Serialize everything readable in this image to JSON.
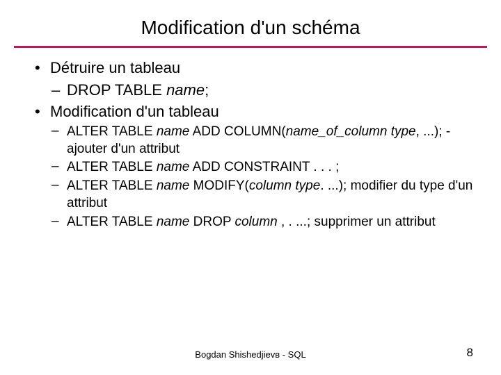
{
  "title": "Modification d'un schéma",
  "bullets": {
    "b1": "Détruire un tableau",
    "b1_1_pre": "DROP TABLE ",
    "b1_1_it": "name",
    "b1_1_post": ";",
    "b2": "Modification d'un tableau",
    "b2_1_a": "ALTER TABLE ",
    "b2_1_b": "name",
    "b2_1_c": " ADD COLUMN(",
    "b2_1_d": "name_of_column type",
    "b2_1_e": ", ...);  - ajouter d'un attribut",
    "b2_2_a": "ALTER TABLE ",
    "b2_2_b": "name",
    "b2_2_c": " ADD CONSTRAINT . . . ;",
    "b2_3_a": "ALTER TABLE ",
    "b2_3_b": "name",
    "b2_3_c": " MODIFY(",
    "b2_3_d": "column type",
    "b2_3_e": ". ...); modifier du type d'un attribut",
    "b2_4_a": "ALTER TABLE ",
    "b2_4_b": "name",
    "b2_4_c": " DROP ",
    "b2_4_d": "column",
    "b2_4_e": " , . ...; supprimer un attribut"
  },
  "footer": {
    "center": "Bogdan Shishedjievв - SQL",
    "page": "8"
  }
}
